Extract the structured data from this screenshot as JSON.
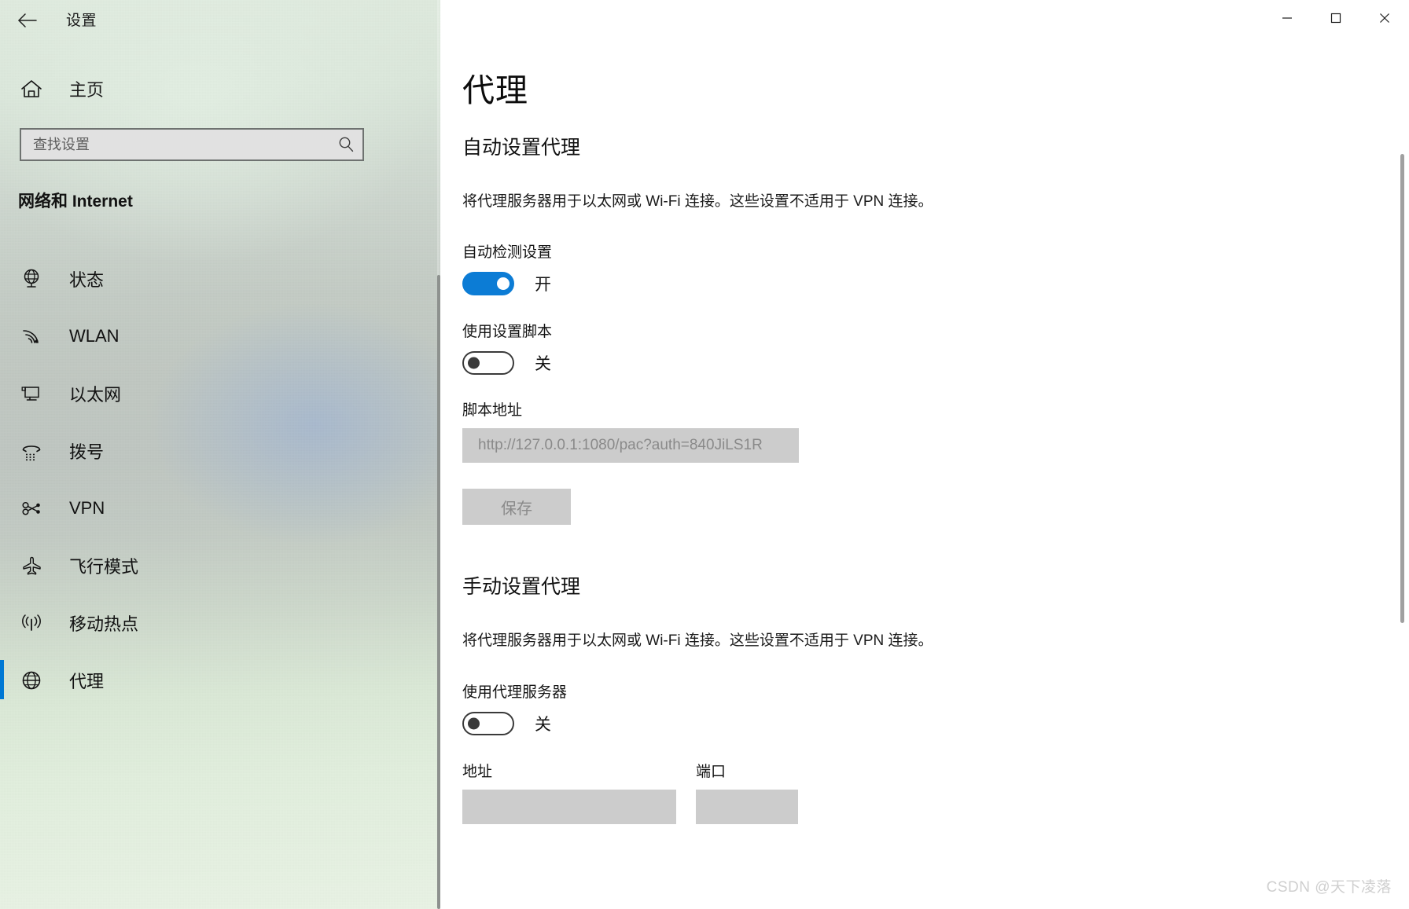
{
  "window": {
    "app_title": "设置",
    "back_label": "返回",
    "controls": {
      "minimize": "最小化",
      "maximize": "最大化",
      "close": "关闭"
    }
  },
  "sidebar": {
    "home_label": "主页",
    "home_icon": "home-icon",
    "search": {
      "placeholder": "查找设置",
      "value": "",
      "icon": "search-icon"
    },
    "section_title": "网络和 Internet",
    "items": [
      {
        "label": "状态",
        "icon": "globe-status-icon",
        "selected": false
      },
      {
        "label": "WLAN",
        "icon": "wifi-icon",
        "selected": false
      },
      {
        "label": "以太网",
        "icon": "ethernet-monitor-icon",
        "selected": false
      },
      {
        "label": "拨号",
        "icon": "dialup-phone-icon",
        "selected": false
      },
      {
        "label": "VPN",
        "icon": "vpn-key-icon",
        "selected": false
      },
      {
        "label": "飞行模式",
        "icon": "airplane-icon",
        "selected": false
      },
      {
        "label": "移动热点",
        "icon": "hotspot-icon",
        "selected": false
      },
      {
        "label": "代理",
        "icon": "globe-proxy-icon",
        "selected": true
      }
    ]
  },
  "main": {
    "page_title": "代理",
    "auto_section": {
      "heading": "自动设置代理",
      "description": "将代理服务器用于以太网或 Wi-Fi 连接。这些设置不适用于 VPN 连接。",
      "auto_detect": {
        "label": "自动检测设置",
        "state_text": "开",
        "on": true
      },
      "use_script": {
        "label": "使用设置脚本",
        "state_text": "关",
        "on": false
      },
      "script_address": {
        "label": "脚本地址",
        "value": "http://127.0.0.1:1080/pac?auth=840JiLS1R",
        "disabled": true
      },
      "save_button": {
        "label": "保存",
        "disabled": true
      }
    },
    "manual_section": {
      "heading": "手动设置代理",
      "description": "将代理服务器用于以太网或 Wi-Fi 连接。这些设置不适用于 VPN 连接。",
      "use_proxy": {
        "label": "使用代理服务器",
        "state_text": "关",
        "on": false
      },
      "address_field": {
        "label": "地址",
        "value": "",
        "disabled": true
      },
      "port_field": {
        "label": "端口",
        "value": "",
        "disabled": true
      }
    }
  },
  "watermark": "CSDN @天下凌落",
  "colors": {
    "accent": "#0078d4",
    "toggle_on": "#0c7cd5",
    "disabled_bg": "#cccccc",
    "disabled_text": "#8a8a8a"
  }
}
